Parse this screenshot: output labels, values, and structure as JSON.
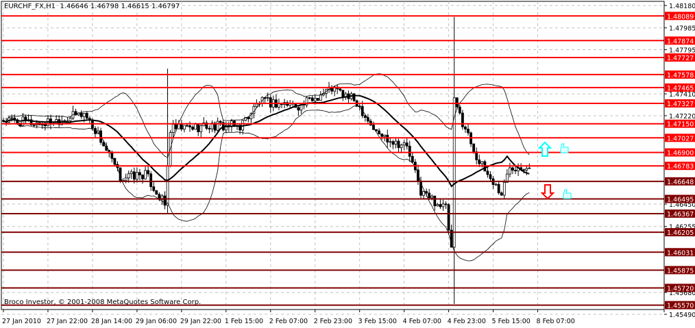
{
  "header": {
    "symbol": "EURCHF_FX,H1",
    "ohlc": "1.46646 1.46798 1.46615 1.46797"
  },
  "footer": {
    "copyright": "Broco Investor, © 2001-2008 MetaQuotes Software Corp."
  },
  "colors": {
    "bright_line": "#ff0000",
    "dark_line": "#800000",
    "up_arrow": "#00ffff",
    "down_arrow": "#ff0000",
    "grid": "#c0c0c0"
  },
  "chart_data": {
    "type": "candlestick",
    "ylim": [
      1.4549,
      1.4818
    ],
    "y_ticks": [
      "1.48180",
      "1.47985",
      "1.47795",
      "1.47410",
      "1.47220",
      "1.46450",
      "1.46255",
      "1.45680",
      "1.45490"
    ],
    "x_ticks": [
      "27 Jan 2010",
      "27 Jan 22:00",
      "28 Jan 14:00",
      "29 Jan 06:00",
      "29 Jan 22:00",
      "1 Feb 15:00",
      "2 Feb 07:00",
      "2 Feb 23:00",
      "3 Feb 15:00",
      "4 Feb 07:00",
      "4 Feb 23:00",
      "5 Feb 15:00",
      "8 Feb 07:00"
    ],
    "bars_per_tick": 16,
    "price_path": [
      [
        0,
        1.4718
      ],
      [
        14,
        1.4715
      ],
      [
        29,
        1.4724
      ],
      [
        34,
        1.4706
      ],
      [
        42,
        1.4668
      ],
      [
        51,
        1.4671
      ],
      [
        58,
        1.4644
      ],
      [
        60,
        1.471
      ],
      [
        73,
        1.4713
      ],
      [
        85,
        1.4713
      ],
      [
        92,
        1.4734
      ],
      [
        107,
        1.4731
      ],
      [
        118,
        1.4746
      ],
      [
        127,
        1.4734
      ],
      [
        134,
        1.4707
      ],
      [
        145,
        1.4695
      ],
      [
        150,
        1.4656
      ],
      [
        159,
        1.4641
      ],
      [
        161,
        1.4605
      ],
      [
        162,
        1.4734
      ],
      [
        166,
        1.4711
      ],
      [
        171,
        1.4681
      ],
      [
        179,
        1.4654
      ],
      [
        182,
        1.4678
      ],
      [
        189,
        1.4679
      ]
    ],
    "spikes": [
      [
        59,
        1.4763,
        1.4637
      ],
      [
        162,
        1.4808,
        1.4558
      ]
    ],
    "indicators": [
      "Moving Average (20)",
      "Bollinger Bands (20,2)"
    ],
    "levels": [
      {
        "price": "1.48089",
        "style": "bright"
      },
      {
        "price": "1.47874",
        "style": "bright"
      },
      {
        "price": "1.47727",
        "style": "bright"
      },
      {
        "price": "1.47578",
        "style": "bright"
      },
      {
        "price": "1.47465",
        "style": "bright"
      },
      {
        "price": "1.47327",
        "style": "bright"
      },
      {
        "price": "1.47150",
        "style": "bright"
      },
      {
        "price": "1.47027",
        "style": "bright"
      },
      {
        "price": "1.46900",
        "style": "bright"
      },
      {
        "price": "1.46783",
        "style": "bright"
      },
      {
        "price": "1.46648",
        "style": "dark"
      },
      {
        "price": "1.46495",
        "style": "dark"
      },
      {
        "price": "1.46367",
        "style": "dark"
      },
      {
        "price": "1.46205",
        "style": "dark"
      },
      {
        "price": "1.46031",
        "style": "dark"
      },
      {
        "price": "1.45875",
        "style": "dark"
      },
      {
        "price": "1.45720",
        "style": "dark"
      },
      {
        "price": "1.45570",
        "style": "dark"
      }
    ]
  }
}
